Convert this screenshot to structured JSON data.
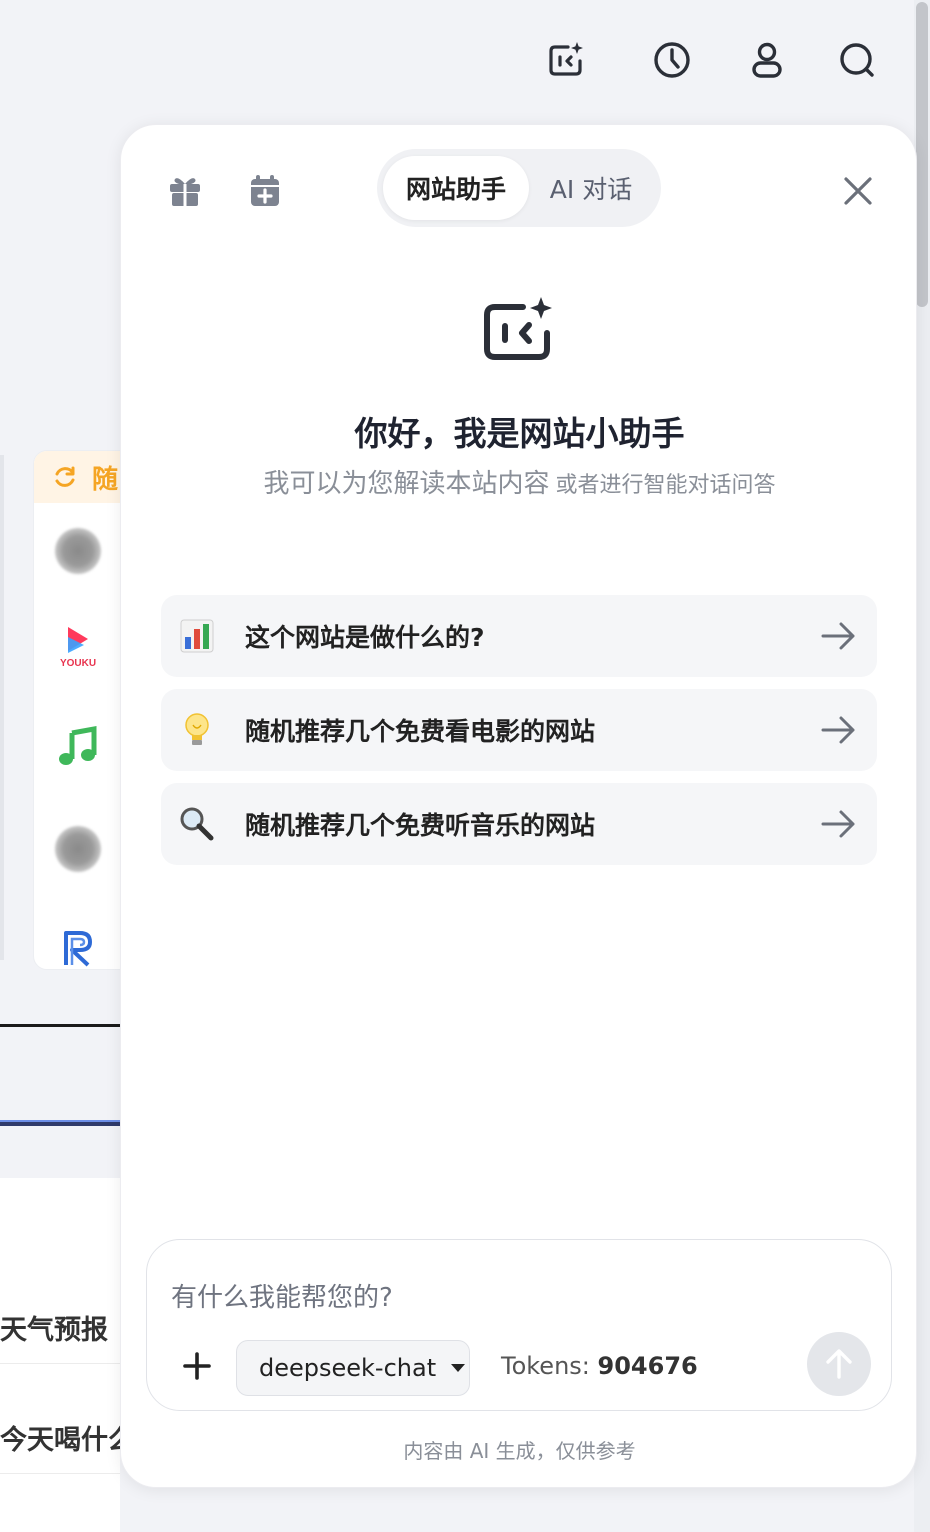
{
  "background": {
    "recommend_card_title": "随",
    "sites": [
      "globe-blur",
      "youku",
      "music-note",
      "globe-blur",
      "r-logo"
    ],
    "youku_label": "YOUKU",
    "list_items": [
      "天气预报",
      "今天喝什么"
    ]
  },
  "top_bar": {
    "icons": [
      "ai-assistant-icon",
      "history-icon",
      "user-icon",
      "search-icon"
    ]
  },
  "panel": {
    "left_icons": [
      "gift-icon",
      "calendar-add-icon"
    ],
    "tabs": [
      {
        "label": "网站助手",
        "active": true
      },
      {
        "label": "AI 对话",
        "active": false
      }
    ],
    "greeting": "你好，我是网站小助手",
    "subtitle_main": "我可以为您解读本站内容",
    "subtitle_extra": "或者进行智能对话问答",
    "suggestions": [
      {
        "icon": "bar-chart-emoji",
        "label": "这个网站是做什么的?"
      },
      {
        "icon": "light-bulb-emoji",
        "label": "随机推荐几个免费看电影的网站"
      },
      {
        "icon": "magnifier-emoji",
        "label": "随机推荐几个免费听音乐的网站"
      }
    ],
    "composer": {
      "placeholder": "有什么我能帮您的?",
      "model": "deepseek-chat",
      "tokens_label": "Tokens:",
      "tokens_value": "904676"
    },
    "disclaimer": "内容由 AI 生成，仅供参考"
  },
  "colors": {
    "accent_orange": "#f5a524",
    "panel_bg": "#ffffff",
    "page_bg": "#f2f3f7",
    "icon_dark": "#2b2f38",
    "icon_gray": "#7d8390"
  }
}
